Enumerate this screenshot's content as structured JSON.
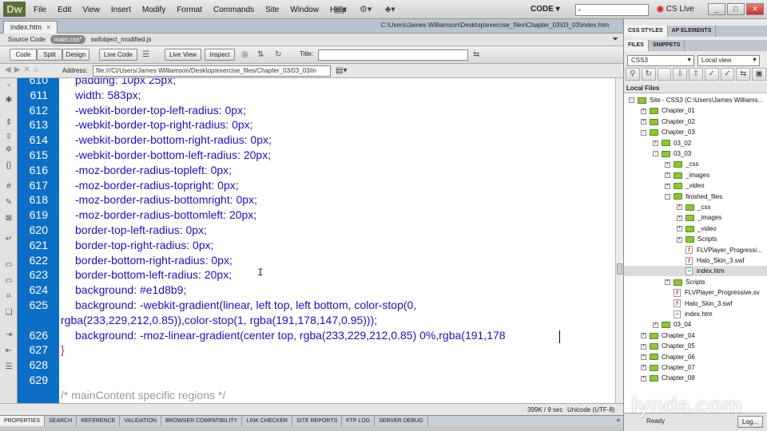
{
  "app": {
    "logo": "Dw",
    "menu": [
      "File",
      "Edit",
      "View",
      "Insert",
      "Modify",
      "Format",
      "Commands",
      "Site",
      "Window",
      "Help"
    ],
    "workspace": "CODE",
    "cs_live": "CS Live",
    "window_buttons": {
      "min": "_",
      "max": "□",
      "close": "✕"
    }
  },
  "document": {
    "tab_label": "index.htm",
    "tab_close": "×",
    "path": "C:\\Users\\James Williamson\\Desktop\\exercise_files\\Chapter_03\\03_03\\index.htm",
    "related": {
      "source": "Source Code",
      "files": [
        "main.css*",
        "swfobject_modified.js"
      ]
    }
  },
  "view_toolbar": {
    "buttons": [
      "Code",
      "Split",
      "Design",
      "Live Code",
      "Live View",
      "Inspect"
    ],
    "title_label": "Title:",
    "title_value": ""
  },
  "address_bar": {
    "label": "Address:",
    "value": "file:///C|/Users/James Williamson/Desktop/exercise_files/Chapter_03/03_03/in"
  },
  "code_lines": [
    {
      "num": "610",
      "text": "padding: 10px 25px;",
      "indent": 1
    },
    {
      "num": "611",
      "text": "width: 583px;",
      "indent": 1
    },
    {
      "num": "612",
      "text": "-webkit-border-top-left-radius: 0px;",
      "indent": 1
    },
    {
      "num": "613",
      "text": "-webkit-border-top-right-radius: 0px;",
      "indent": 1
    },
    {
      "num": "614",
      "text": "-webkit-border-bottom-right-radius: 0px;",
      "indent": 1
    },
    {
      "num": "615",
      "text": "-webkit-border-bottom-left-radius: 20px;",
      "indent": 1
    },
    {
      "num": "616",
      "text": "-moz-border-radius-topleft: 0px;",
      "indent": 1
    },
    {
      "num": "617",
      "text": "-moz-border-radius-topright: 0px;",
      "indent": 1
    },
    {
      "num": "618",
      "text": "-moz-border-radius-bottomright: 0px;",
      "indent": 1
    },
    {
      "num": "619",
      "text": "-moz-border-radius-bottomleft: 20px;",
      "indent": 1
    },
    {
      "num": "620",
      "text": "border-top-left-radius: 0px;",
      "indent": 1
    },
    {
      "num": "621",
      "text": "border-top-right-radius: 0px;",
      "indent": 1
    },
    {
      "num": "622",
      "text": "border-bottom-right-radius: 0px;",
      "indent": 1
    },
    {
      "num": "623",
      "text": "border-bottom-left-radius: 20px;",
      "indent": 1
    },
    {
      "num": "624",
      "text": "background: #e1d8b9;",
      "indent": 1
    },
    {
      "num": "625",
      "text": "background: -webkit-gradient(linear, left top, left bottom, color-stop(0,",
      "indent": 1
    },
    {
      "num": "",
      "text": "rgba(233,229,212,0.85)),color-stop(1, rgba(191,178,147,0.95)));",
      "indent": 0
    },
    {
      "num": "626",
      "text": "background: -moz-linear-gradient(center top, rgba(233,229,212,0.85) 0%,rgba(191,178",
      "indent": 1
    },
    {
      "num": "627",
      "text": "}",
      "indent": 0,
      "brace": true
    },
    {
      "num": "628",
      "text": "",
      "indent": 0
    },
    {
      "num": "629",
      "text": "",
      "indent": 0
    },
    {
      "num": "",
      "text": "/* mainContent specific regions */",
      "indent": 0,
      "comment": true
    }
  ],
  "status": {
    "size": "399K / 9 sec",
    "encoding": "Unicode (UTF-8)"
  },
  "properties_tabs": [
    "PROPERTIES",
    "SEARCH",
    "REFERENCE",
    "VALIDATION",
    "BROWSER COMPATIBILITY",
    "LINK CHECKER",
    "SITE REPORTS",
    "FTP LOG",
    "SERVER DEBUG"
  ],
  "right_panel": {
    "tabs_top": [
      "CSS STYLES",
      "AP ELEMENTS"
    ],
    "tabs_files": [
      "FILES",
      "SNIPPETS"
    ],
    "site_select": "CSS3",
    "view_select": "Local view",
    "header": "Local Files",
    "tree": [
      {
        "label": "Site - CSS3 (C:\\Users\\James Williams...",
        "level": 0,
        "type": "folder",
        "exp": "-"
      },
      {
        "label": "Chapter_01",
        "level": 1,
        "type": "folder",
        "exp": "+"
      },
      {
        "label": "Chapter_02",
        "level": 1,
        "type": "folder",
        "exp": "+"
      },
      {
        "label": "Chapter_03",
        "level": 1,
        "type": "folder",
        "exp": "-"
      },
      {
        "label": "03_02",
        "level": 2,
        "type": "folder",
        "exp": "+"
      },
      {
        "label": "03_03",
        "level": 2,
        "type": "folder",
        "exp": "-"
      },
      {
        "label": "_css",
        "level": 3,
        "type": "folder",
        "exp": "+"
      },
      {
        "label": "_images",
        "level": 3,
        "type": "folder",
        "exp": "+"
      },
      {
        "label": "_video",
        "level": 3,
        "type": "folder",
        "exp": "+"
      },
      {
        "label": "finished_files",
        "level": 3,
        "type": "folder",
        "exp": "-"
      },
      {
        "label": "_css",
        "level": 4,
        "type": "folder",
        "exp": "+"
      },
      {
        "label": "_images",
        "level": 4,
        "type": "folder",
        "exp": "+"
      },
      {
        "label": "_video",
        "level": 4,
        "type": "folder",
        "exp": "+"
      },
      {
        "label": "Scripts",
        "level": 4,
        "type": "folder",
        "exp": "+"
      },
      {
        "label": "FLVPlayer_Progressi...",
        "level": 4,
        "type": "swf",
        "exp": ""
      },
      {
        "label": "Halo_Skin_3.swf",
        "level": 4,
        "type": "swf",
        "exp": ""
      },
      {
        "label": "index.htm",
        "level": 4,
        "type": "htm",
        "exp": "",
        "selected": true
      },
      {
        "label": "Scripts",
        "level": 3,
        "type": "folder",
        "exp": "+"
      },
      {
        "label": "FLVPlayer_Progressive.sv",
        "level": 3,
        "type": "swf",
        "exp": ""
      },
      {
        "label": "Halo_Skin_3.swf",
        "level": 3,
        "type": "swf",
        "exp": ""
      },
      {
        "label": "index.htm",
        "level": 3,
        "type": "htm",
        "exp": ""
      },
      {
        "label": "03_04",
        "level": 2,
        "type": "folder",
        "exp": "+"
      },
      {
        "label": "Chapter_04",
        "level": 1,
        "type": "folder",
        "exp": "+"
      },
      {
        "label": "Chapter_05",
        "level": 1,
        "type": "folder",
        "exp": "+"
      },
      {
        "label": "Chapter_06",
        "level": 1,
        "type": "folder",
        "exp": "+"
      },
      {
        "label": "Chapter_07",
        "level": 1,
        "type": "folder",
        "exp": "+"
      },
      {
        "label": "Chapter_08",
        "level": 1,
        "type": "folder",
        "exp": "+"
      }
    ],
    "status": "Ready",
    "log_button": "Log..."
  },
  "watermark": "lynda.com",
  "colors": {
    "gutter": "#0c6ec4",
    "code_text": "#1c12b8",
    "brace": "#c01a9a"
  }
}
